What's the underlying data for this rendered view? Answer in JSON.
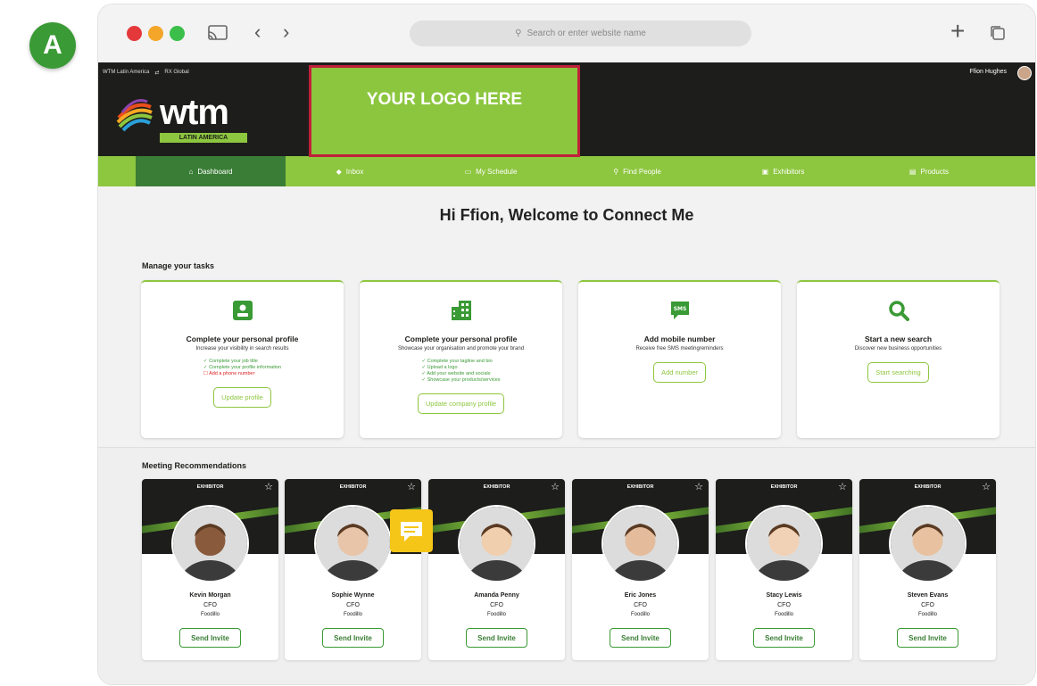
{
  "badge": "A",
  "browser": {
    "address_placeholder": "Search or enter website name"
  },
  "header": {
    "top_links": [
      "WTM Latin America",
      "RX Global"
    ],
    "user_name": "Ffion Hughes",
    "logo_text": "wtm",
    "logo_subtext": "LATIN AMERICA",
    "logo_placeholder": "YOUR LOGO HERE"
  },
  "nav": [
    {
      "label": "Dashboard",
      "icon": "home-icon",
      "active": true
    },
    {
      "label": "Inbox",
      "icon": "chat-icon",
      "active": false
    },
    {
      "label": "My Schedule",
      "icon": "calendar-icon",
      "active": false
    },
    {
      "label": "Find People",
      "icon": "search-icon",
      "active": false
    },
    {
      "label": "Exhibitors",
      "icon": "exhibitor-icon",
      "active": false
    },
    {
      "label": "Products",
      "icon": "product-icon",
      "active": false
    }
  ],
  "welcome": "Hi Ffion, Welcome to Connect Me",
  "tasks_title": "Manage your tasks",
  "tasks": [
    {
      "icon": "profile-card-icon",
      "title": "Complete your personal profile",
      "desc": "Increase your visibility in search results",
      "checklist": [
        {
          "text": "Complete your job title",
          "done": true
        },
        {
          "text": "Complete your profile information",
          "done": true
        },
        {
          "text": "Add a phone number",
          "done": false
        }
      ],
      "button": "Update profile"
    },
    {
      "icon": "building-icon",
      "title": "Complete your personal profile",
      "desc": "Showcase your organisation and promote your brand",
      "checklist": [
        {
          "text": "Complete your tagline and bio",
          "done": true
        },
        {
          "text": "Upload a logo",
          "done": true
        },
        {
          "text": "Add your website and socials",
          "done": true
        },
        {
          "text": "Showcase your products/services",
          "done": true
        }
      ],
      "button": "Update company profile"
    },
    {
      "icon": "sms-icon",
      "title": "Add mobile number",
      "desc": "Receive free SMS meetingreminders",
      "checklist": [],
      "button": "Add number"
    },
    {
      "icon": "magnifier-icon",
      "title": "Start a new search",
      "desc": "Discover new business opportunities",
      "checklist": [],
      "button": "Start searching"
    }
  ],
  "meetings_title": "Meeting Recommendations",
  "people": [
    {
      "label": "EXHIBITOR",
      "name": "Kevin Morgan",
      "role": "CFO",
      "company": "Foodillo",
      "button": "Send Invite",
      "skin": "#8a5a3c"
    },
    {
      "label": "EXHIBITOR",
      "name": "Sophie Wynne",
      "role": "CFO",
      "company": "Foodillo",
      "button": "Send Invite",
      "skin": "#e8c4a8"
    },
    {
      "label": "EXHIBITOR",
      "name": "Amanda Penny",
      "role": "CFO",
      "company": "Foodillo",
      "button": "Send Invite",
      "skin": "#f0cfae"
    },
    {
      "label": "EXHIBITOR",
      "name": "Eric Jones",
      "role": "CFO",
      "company": "Foodillo",
      "button": "Send Invite",
      "skin": "#e4bc9c"
    },
    {
      "label": "EXHIBITOR",
      "name": "Stacy Lewis",
      "role": "CFO",
      "company": "Foodillo",
      "button": "Send Invite",
      "skin": "#f2d2b6"
    },
    {
      "label": "EXHIBITOR",
      "name": "Steven Evans",
      "role": "CFO",
      "company": "Foodillo",
      "button": "Send Invite",
      "skin": "#e8c2a0"
    }
  ],
  "colors": {
    "brand_green": "#8dc63f",
    "dark_green": "#3a7d36",
    "header_dark": "#1d1d1b",
    "logo_border": "#c0203a"
  }
}
